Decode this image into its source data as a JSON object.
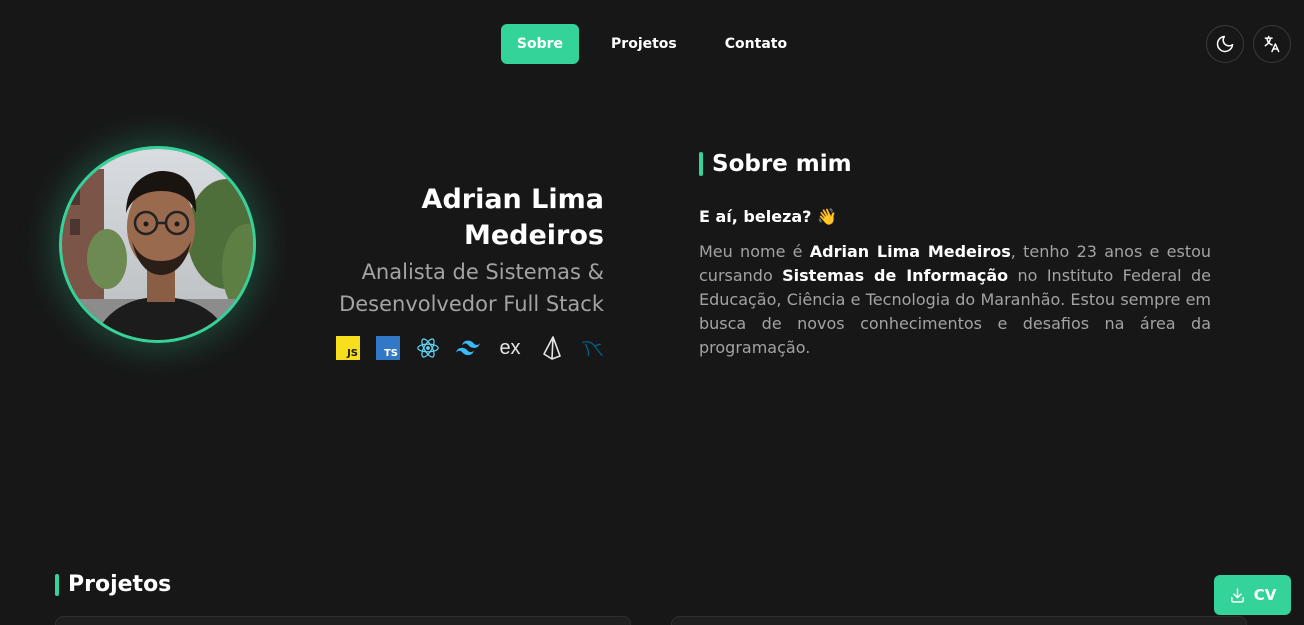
{
  "nav": {
    "items": [
      {
        "label": "Sobre",
        "active": true
      },
      {
        "label": "Projetos",
        "active": false
      },
      {
        "label": "Contato",
        "active": false
      }
    ],
    "theme_icon": "moon-icon",
    "language_icon": "translate-icon"
  },
  "profile": {
    "name": "Adrian Lima Medeiros",
    "role_line1": "Analista de Sistemas &",
    "role_line2": "Desenvolvedor Full Stack",
    "tech_icons": [
      {
        "name": "javascript-icon",
        "text": "JS"
      },
      {
        "name": "typescript-icon",
        "text": "TS"
      },
      {
        "name": "react-icon"
      },
      {
        "name": "tailwind-icon"
      },
      {
        "name": "express-icon",
        "text": "ex"
      },
      {
        "name": "prisma-icon"
      },
      {
        "name": "mysql-icon"
      }
    ]
  },
  "about": {
    "heading": "Sobre mim",
    "greeting": "E aí, beleza? 👋",
    "paragraph": {
      "p1": "Meu nome é ",
      "name": "Adrian Lima Medeiros",
      "p2": ", tenho 23 anos e estou cursando ",
      "course": "Sistemas de Informação",
      "p3": " no Instituto Federal de Educação, Ciência e Tecnologia do Maranhão. Estou sempre em busca de novos conhecimentos e desafios na área da programação."
    }
  },
  "projects": {
    "heading": "Projetos"
  },
  "cv_button": {
    "label": "CV",
    "icon": "download-icon"
  },
  "colors": {
    "accent": "#34d399",
    "background": "#171717",
    "muted_text": "#a3a3a3"
  }
}
